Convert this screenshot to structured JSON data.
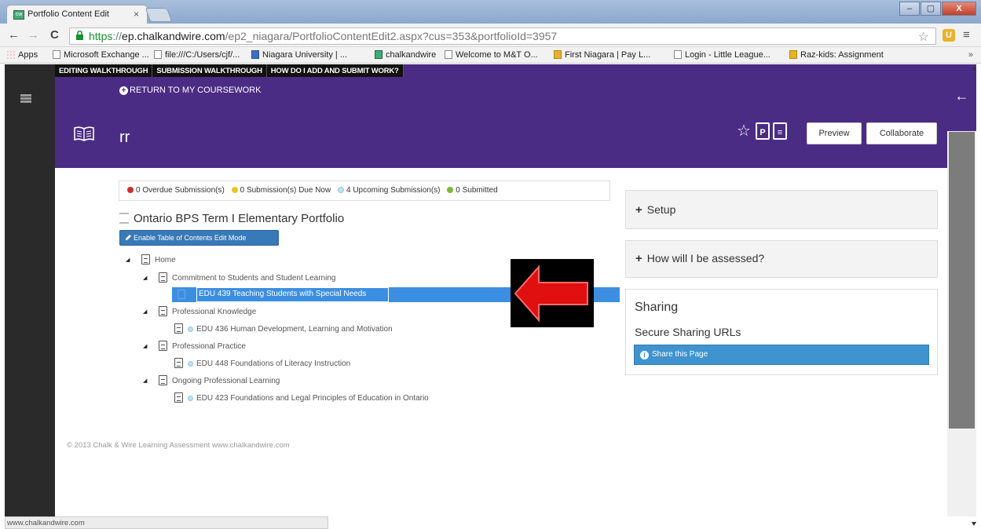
{
  "browser": {
    "tab_title": "Portfolio Content Edit",
    "tab_close": "×",
    "favicon_text": "cw",
    "url_scheme": "https",
    "url_host": "ep.chalkandwire.com",
    "url_path": "/ep2_niagara/PortfolioContentEdit2.aspx?cus=353&portfolioId=3957",
    "url_separator": "://",
    "back_glyph": "←",
    "forward_glyph": "→",
    "reload_glyph": "C",
    "star_glyph": "☆",
    "menu_glyph": "≡",
    "ext_glyph": "U",
    "win_min": "–",
    "win_max": "▢",
    "win_close": "X",
    "bookmarks": [
      "Apps",
      "Microsoft Exchange ...",
      "file:///C:/Users/cjf/...",
      "Niagara University | ...",
      "chalkandwire",
      "Welcome to M&T O...",
      "First Niagara | Pay L...",
      "Login - Little League...",
      "Raz-kids: Assignment"
    ],
    "bookmarks_more": "»",
    "status_url": "www.chalkandwire.com"
  },
  "header": {
    "help_links": [
      "EDITING WALKTHROUGH",
      "SUBMISSION WALKTHROUGH",
      "HOW DO I ADD AND SUBMIT WORK?"
    ],
    "return_label": "RETURN TO MY COURSEWORK",
    "return_glyph": "+",
    "title": "rr",
    "star_glyph": "☆",
    "pdf_glyph": "P",
    "doc_glyph": "≡",
    "preview_label": "Preview",
    "collaborate_label": "Collaborate",
    "back_glyph": "←"
  },
  "submissions": {
    "overdue": "0 Overdue Submission(s)",
    "due_now": "0 Submission(s) Due Now",
    "upcoming": "4 Upcoming Submission(s)",
    "submitted": "0 Submitted"
  },
  "portfolio": {
    "title": "Ontario BPS Term I Elementary Portfolio",
    "enable_label": "Enable Table of Contents Edit Mode",
    "tree": {
      "home": "Home",
      "commitment": "Commitment to Students and Student Learning",
      "edu439": "EDU 439 Teaching Students with Special Needs",
      "knowledge": "Professional Knowledge",
      "edu436": "EDU 436 Human Development, Learning and Motivation",
      "practice": "Professional Practice",
      "edu448": "EDU 448 Foundations of Literacy Instruction",
      "ongoing": "Ongoing Professional Learning",
      "edu423": "EDU 423 Foundations and Legal Principles of Education in Ontario"
    },
    "triangle_glyph": "◢"
  },
  "footer": {
    "copyright": "© 2013 Chalk & Wire Learning Assessment   www.chalkandwire.com"
  },
  "sidebar": {
    "setup_label": "Setup",
    "assessed_label": "How will I be assessed?",
    "plus_glyph": "+",
    "sharing_title": "Sharing",
    "sharing_subtitle": "Secure Sharing URLs",
    "share_button": "Share this Page",
    "info_glyph": "i"
  },
  "colors": {
    "header_purple": "#4b2c84",
    "selection_blue": "#3c8fe0",
    "overdue_dot": "#c8302c",
    "due_now_dot": "#e8c52a",
    "upcoming_dot": "#bfe1f3",
    "submitted_dot": "#7cb83a",
    "annotation_arrow": "#e01010"
  },
  "annotation": {
    "arrow": "red arrow pointing left at selected item"
  }
}
